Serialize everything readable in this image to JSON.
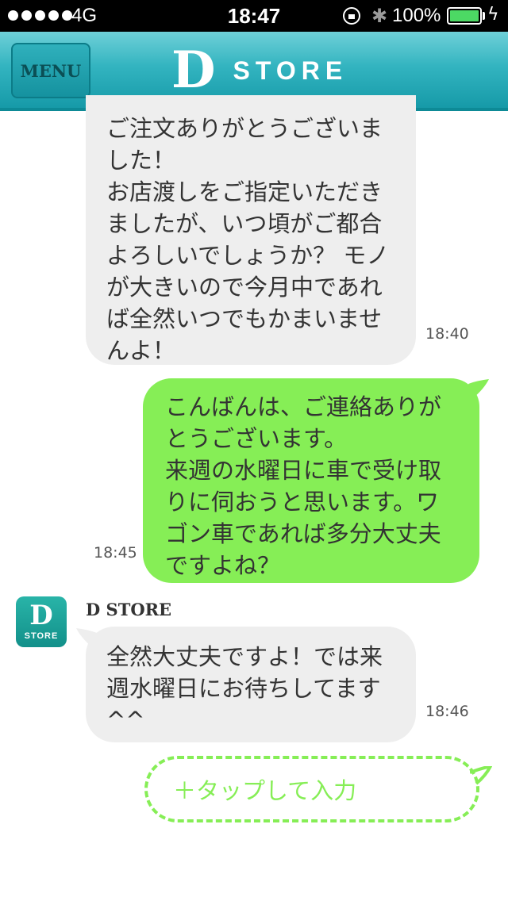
{
  "status_bar": {
    "carrier": "4G",
    "time": "18:47",
    "battery_percent": "100%",
    "battery_level": 1.0
  },
  "nav": {
    "menu_label": "MENU",
    "logo_letter": "D",
    "logo_text": "STORE"
  },
  "messages": [
    {
      "direction": "incoming",
      "lines": [
        "ご注文ありがとうございま",
        "した！",
        "お店渡しをご指定いただき",
        "ましたが、いつ頃がご都合",
        "よろしいでしょうか？ モノ",
        "が大きいので今月中であれ",
        "ば全然いつでもかまいませ",
        "んよ！"
      ],
      "time": "18:40"
    },
    {
      "direction": "outgoing",
      "lines": [
        "こんばんは、ご連絡ありが",
        "とうございます。",
        "来週の水曜日に車で受け取",
        "りに伺おうと思います。ワ",
        "ゴン車であれば多分大丈夫",
        "ですよね？"
      ],
      "time": "18:45"
    },
    {
      "direction": "incoming",
      "sender": "D STORE",
      "avatar_letter": "D",
      "avatar_text": "STORE",
      "lines": [
        "全然大丈夫ですよ！では来",
        "週水曜日にお待ちしてます",
        "^^"
      ],
      "time": "18:46"
    }
  ],
  "input": {
    "label": "＋タップして入力"
  },
  "colors": {
    "nav": "#33b4c0",
    "incoming_bubble": "#eeeeee",
    "outgoing_bubble": "#86ee56"
  }
}
